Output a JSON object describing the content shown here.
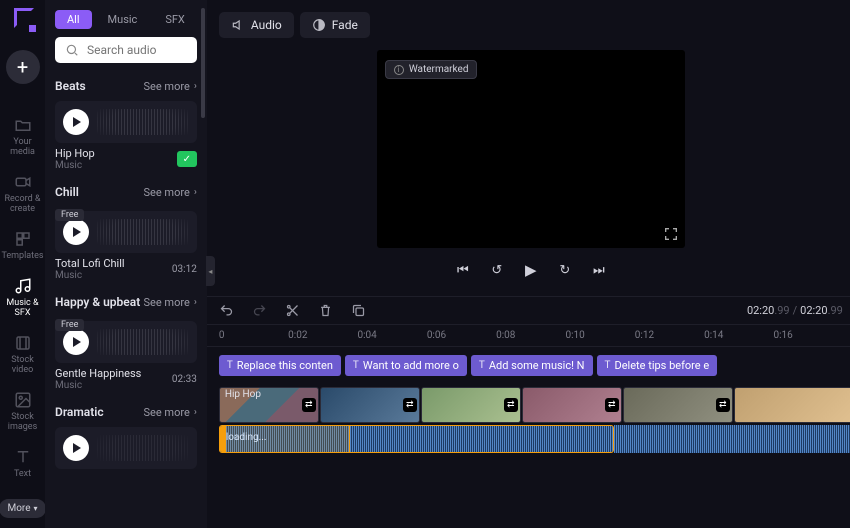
{
  "rail": {
    "add_plus": "+",
    "items": [
      {
        "label": "Your media"
      },
      {
        "label": "Record & create"
      },
      {
        "label": "Templates"
      },
      {
        "label": "Music & SFX"
      },
      {
        "label": "Stock video"
      },
      {
        "label": "Stock images"
      },
      {
        "label": "Text"
      }
    ],
    "more": "More"
  },
  "sidebar": {
    "tabs": {
      "all": "All",
      "music": "Music",
      "sfx": "SFX"
    },
    "search_placeholder": "Search audio",
    "see_more": "See more",
    "free": "Free",
    "categories": [
      {
        "title": "Beats",
        "track": {
          "name": "Hip Hop",
          "sub": "Music",
          "duration": "",
          "selected": true,
          "free": false
        }
      },
      {
        "title": "Chill",
        "track": {
          "name": "Total Lofi Chill",
          "sub": "Music",
          "duration": "03:12",
          "selected": false,
          "free": true
        }
      },
      {
        "title": "Happy & upbeat",
        "track": {
          "name": "Gentle Happiness",
          "sub": "Music",
          "duration": "02:33",
          "selected": false,
          "free": true
        }
      },
      {
        "title": "Dramatic",
        "track": {
          "name": "",
          "sub": "",
          "duration": "",
          "selected": false,
          "free": false
        }
      }
    ]
  },
  "context_toolbar": {
    "audio": "Audio",
    "fade": "Fade"
  },
  "preview": {
    "watermark": "Watermarked"
  },
  "timeline": {
    "current": "02:20",
    "current_ms": ".99",
    "total": "02:20",
    "total_ms": ".99",
    "ruler": [
      "0",
      "0:02",
      "0:04",
      "0:06",
      "0:08",
      "0:10",
      "0:12",
      "0:14",
      "0:16"
    ],
    "tags": [
      "Replace this conten",
      "Want to add more o",
      "Add some music! N",
      "Delete tips before e"
    ],
    "audio_label": "Hip Hop",
    "audio_loading": "loading..."
  }
}
